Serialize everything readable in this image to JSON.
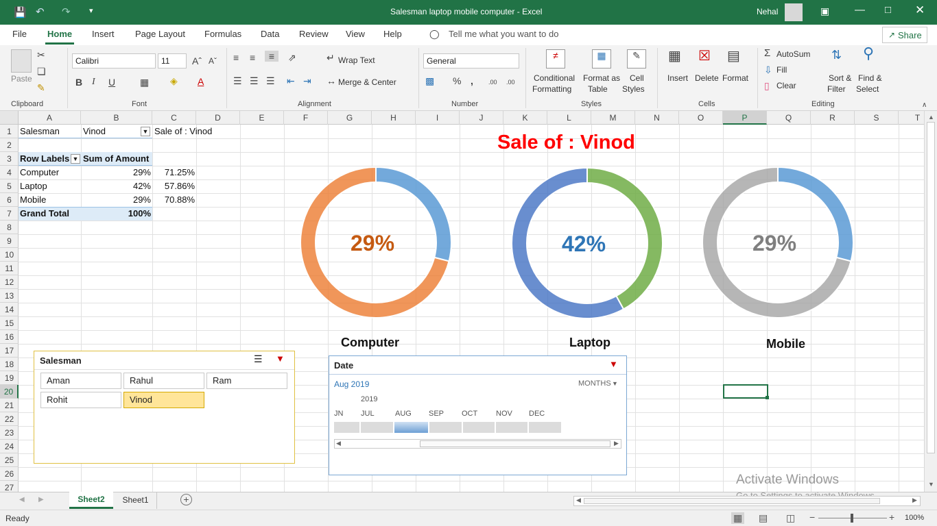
{
  "titlebar": {
    "title": "Salesman laptop mobile computer  -  Excel",
    "user": "Nehal"
  },
  "menu": {
    "items": [
      "File",
      "Home",
      "Insert",
      "Page Layout",
      "Formulas",
      "Data",
      "Review",
      "View",
      "Help"
    ],
    "tell_me": "Tell me what you want to do",
    "share": "Share"
  },
  "ribbon": {
    "paste": "Paste",
    "font_name": "Calibri",
    "font_size": "11",
    "wrap_text": "Wrap Text",
    "merge_center": "Merge & Center",
    "number_format": "General",
    "conditional": [
      "Conditional",
      "Formatting"
    ],
    "format_table": [
      "Format as",
      "Table"
    ],
    "cell_styles": [
      "Cell",
      "Styles"
    ],
    "insert": "Insert",
    "delete": "Delete",
    "format": "Format",
    "autosum": "AutoSum",
    "fill": "Fill",
    "clear": "Clear",
    "sort_filter": [
      "Sort &",
      "Filter"
    ],
    "find_select": [
      "Find &",
      "Select"
    ],
    "groups": {
      "clipboard": "Clipboard",
      "font": "Font",
      "alignment": "Alignment",
      "number": "Number",
      "styles": "Styles",
      "cells": "Cells",
      "editing": "Editing"
    }
  },
  "columns": [
    "A",
    "B",
    "C",
    "D",
    "E",
    "F",
    "G",
    "H",
    "I",
    "J",
    "K",
    "L",
    "M",
    "N",
    "O",
    "P",
    "Q",
    "R",
    "S",
    "T"
  ],
  "rows": [
    "1",
    "2",
    "3",
    "4",
    "5",
    "6",
    "7",
    "8",
    "9",
    "10",
    "11",
    "12",
    "13",
    "14",
    "15",
    "16",
    "17",
    "18",
    "19",
    "20",
    "21",
    "22",
    "23",
    "24",
    "25",
    "26",
    "27"
  ],
  "cells": {
    "a1": "Salesman",
    "b1": "Vinod",
    "c1": "Sale of : Vinod",
    "a3": "Row Labels",
    "b3": "Sum of Amount",
    "a4": "Computer",
    "b4": "29%",
    "c4": "71.25%",
    "a5": "Laptop",
    "b5": "42%",
    "c5": "57.86%",
    "a6": "Mobile",
    "b6": "29%",
    "c6": "70.88%",
    "a7": "Grand Total",
    "b7": "100%"
  },
  "chart_data": {
    "type": "pie",
    "title": "Sale of : Vinod",
    "charts": [
      {
        "category": "Computer",
        "label": "29%",
        "value": 29,
        "colors": [
          "#5b9bd5",
          "#ed7d31"
        ],
        "label_color": "#c55a11"
      },
      {
        "category": "Laptop",
        "label": "42%",
        "value": 42,
        "colors": [
          "#70ad47",
          "#4472c4"
        ],
        "label_color": "#2e75b6"
      },
      {
        "category": "Mobile",
        "label": "29%",
        "value": 29,
        "colors": [
          "#5b9bd5",
          "#a5a5a5"
        ],
        "label_color": "#7f7f7f"
      }
    ]
  },
  "slicer": {
    "title": "Salesman",
    "items": [
      "Aman",
      "Rahul",
      "Ram",
      "Rohit",
      "Vinod"
    ],
    "selected": "Vinod"
  },
  "timeline": {
    "title": "Date",
    "range": "Aug 2019",
    "level": "MONTHS",
    "year": "2019",
    "months": [
      "JN",
      "JUL",
      "AUG",
      "SEP",
      "OCT",
      "NOV",
      "DEC"
    ],
    "selected": "AUG"
  },
  "sheets": {
    "tabs": [
      "Sheet2",
      "Sheet1"
    ],
    "active": "Sheet2"
  },
  "status": {
    "ready": "Ready",
    "zoom": "100%"
  },
  "watermark": {
    "line1": "Activate Windows",
    "line2": "Go to Settings to activate Windows."
  }
}
